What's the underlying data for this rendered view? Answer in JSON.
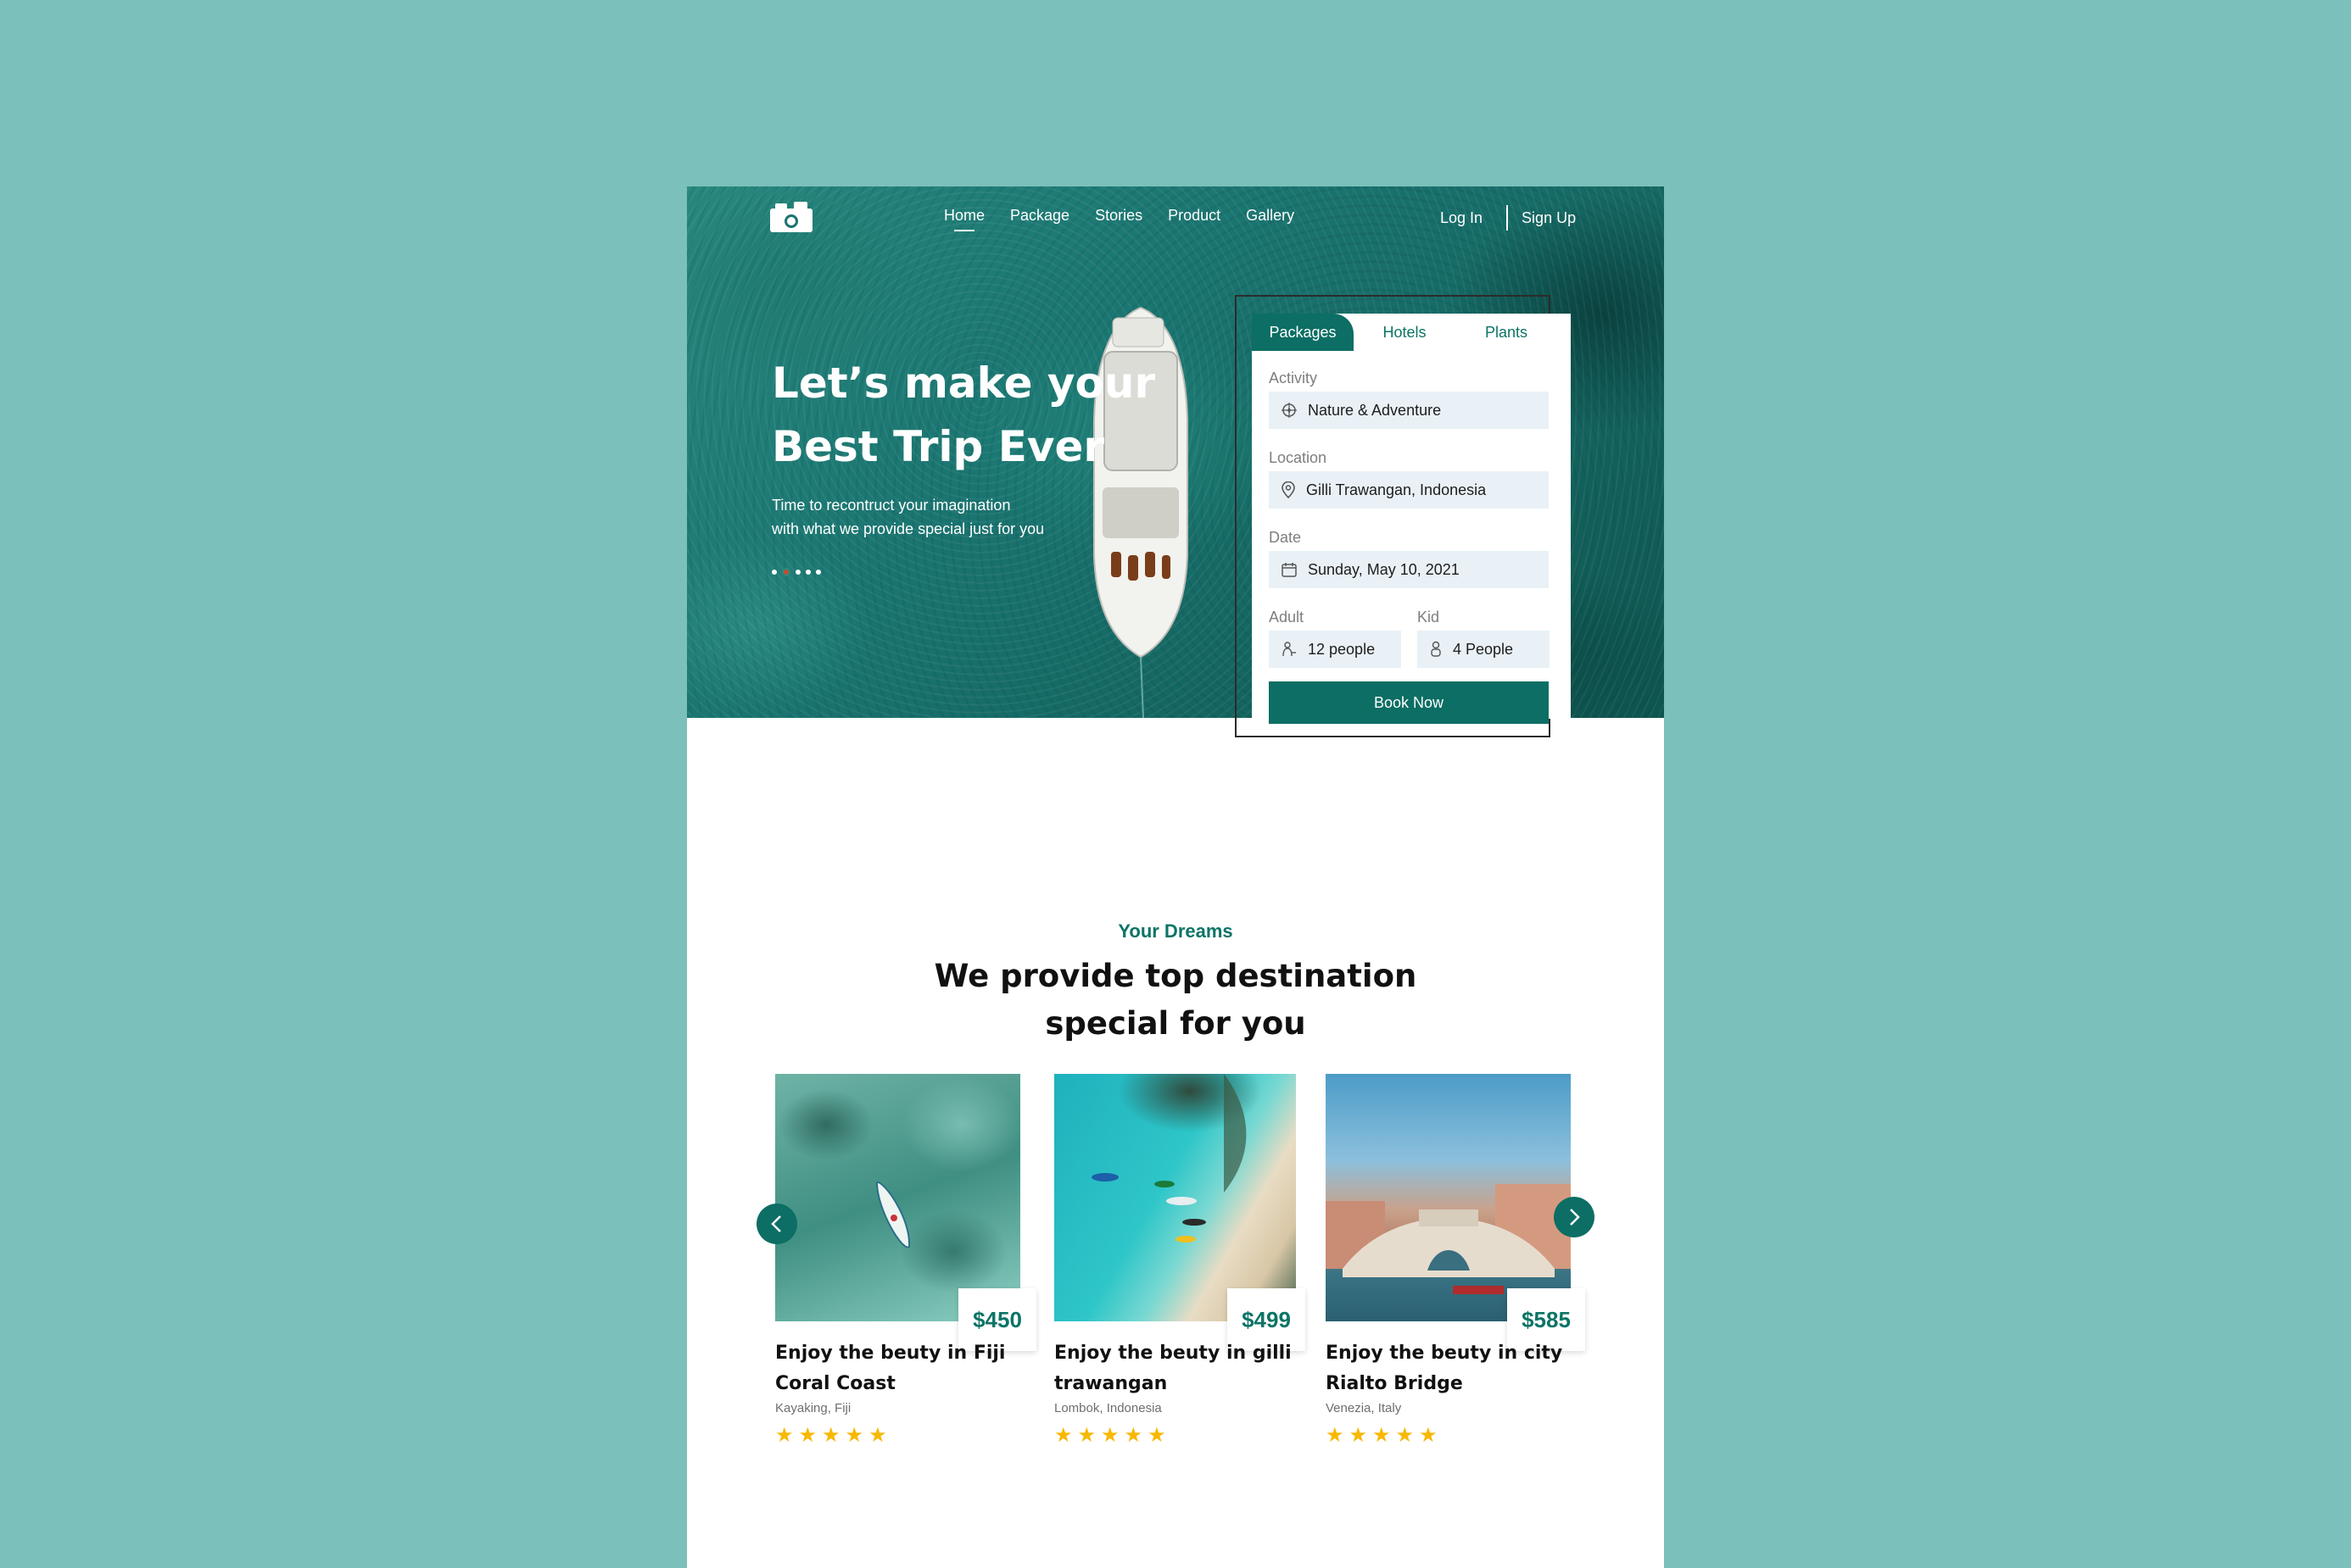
{
  "nav": {
    "links": [
      "Home",
      "Package",
      "Stories",
      "Product",
      "Gallery"
    ],
    "login": "Log In",
    "signup": "Sign Up"
  },
  "hero": {
    "title_line1": "Let’s make your",
    "title_line2": "Best Trip Ever",
    "subtitle_line1": "Time to recontruct your imagination",
    "subtitle_line2": "with what we provide special just for you"
  },
  "booking": {
    "tabs": [
      "Packages",
      "Hotels",
      "Plants"
    ],
    "activity_label": "Activity",
    "activity_value": "Nature & Adventure",
    "location_label": "Location",
    "location_value": "Gilli Trawangan, Indonesia",
    "date_label": "Date",
    "date_value": "Sunday, May 10, 2021",
    "adult_label": "Adult",
    "adult_value": "12 people",
    "kid_label": "Kid",
    "kid_value": "4 People",
    "book_label": "Book Now"
  },
  "section": {
    "kicker": "Your Dreams",
    "heading_line1": "We provide top destination",
    "heading_line2": "special for you"
  },
  "destinations": [
    {
      "price": "$450",
      "title_line1": "Enjoy the beuty in Fiji",
      "title_line2": "Coral Coast",
      "location": "Kayaking, Fiji",
      "rating": 5
    },
    {
      "price": "$499",
      "title_line1": "Enjoy the beuty in gilli",
      "title_line2": "trawangan",
      "location": "Lombok, Indonesia",
      "rating": 5
    },
    {
      "price": "$585",
      "title_line1": "Enjoy the beuty in city",
      "title_line2": "Rialto Bridge",
      "location": "Venezia, Italy",
      "rating": 5
    }
  ],
  "colors": {
    "background": "#7bc0ba",
    "brand": "#0c6e64",
    "star": "#f7b800",
    "field": "#e9f1f6"
  },
  "icons": [
    "camera-icon",
    "compass-icon",
    "map-pin-icon",
    "calendar-icon",
    "adult-icon",
    "kid-icon",
    "chevron-left-icon",
    "chevron-right-icon",
    "star-icon"
  ]
}
